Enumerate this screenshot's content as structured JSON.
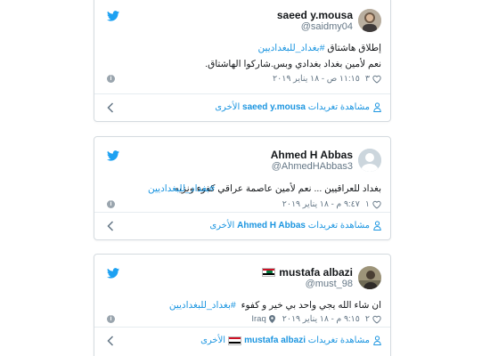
{
  "colors": {
    "link": "#1b95e0",
    "muted": "#657786",
    "text": "#14171a",
    "twitter": "#1da1f2"
  },
  "tweets": [
    {
      "name": "saeed y.mousa",
      "handle": "@saidmy04",
      "lines": [
        "إطلاق هاشتاق ",
        "#بغداد_للبغداديين"
      ],
      "line1_plain": "إطلاق هاشتاق",
      "hashtag": "#بغداد_للبغداديين",
      "line2": "نعم لأمين بغداد بغدادي وبس.شاركوا الهاشتاق.",
      "likes": "٣",
      "timestamp": "١١:١٥ ص - ١٨ يناير ٢٠١٩",
      "footer_prefix": "مشاهدة تغريدات",
      "footer_name": "saeed y.mousa",
      "footer_suffix": "الأخرى"
    },
    {
      "name": "Ahmed H Abbas",
      "handle": "@AhmedHAbbas3",
      "line1_plain": "بغداد للعراقيين ... نعم لأمين عاصمة عراقي كفوء ونزيه",
      "hashtag": "#بغداد_للبغداديين",
      "likes": "١",
      "timestamp": "٩:٤٧ م - ١٨ يناير ٢٠١٩",
      "footer_prefix": "مشاهدة تغريدات",
      "footer_name": "Ahmed H Abbas",
      "footer_suffix": "الأخرى"
    },
    {
      "name": "mustafa albazi",
      "handle": "@must_98",
      "line1_plain": "ان شاء الله يجي واحد بي خير و كفوء",
      "hashtag": "#بغداد_للبغداديين",
      "likes": "٢",
      "timestamp": "٩:١٥ م - ١٨ يناير ٢٠١٩",
      "location": "Iraq",
      "footer_prefix": "مشاهدة تغريدات",
      "footer_name": "mustafa albazi",
      "footer_suffix": "الأخرى"
    }
  ]
}
